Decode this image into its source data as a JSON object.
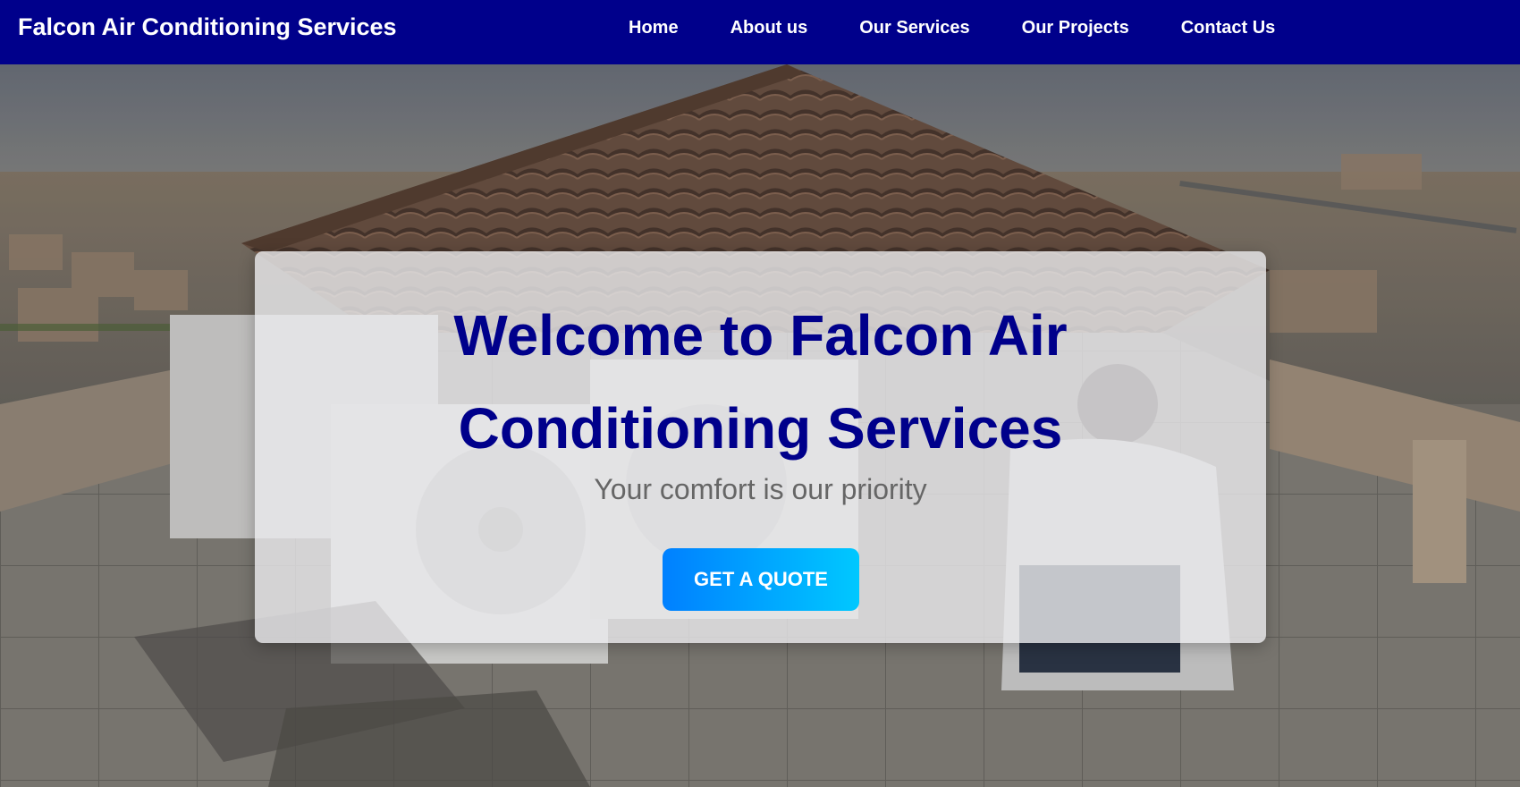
{
  "header": {
    "brand": "Falcon Air Conditioning Services",
    "background_color": "#00008b",
    "nav": [
      {
        "label": "Home"
      },
      {
        "label": "About us"
      },
      {
        "label": "Our Services"
      },
      {
        "label": "Our Projects"
      },
      {
        "label": "Contact Us"
      }
    ]
  },
  "hero": {
    "background_image": "rooftop-ac-units-photo",
    "title": "Welcome to Falcon Air Conditioning Services",
    "subtitle": "Your comfort is our priority",
    "cta_label": "GET A QUOTE",
    "title_color": "#00008b",
    "cta_gradient": [
      "#0080ff",
      "#00c8ff"
    ]
  }
}
